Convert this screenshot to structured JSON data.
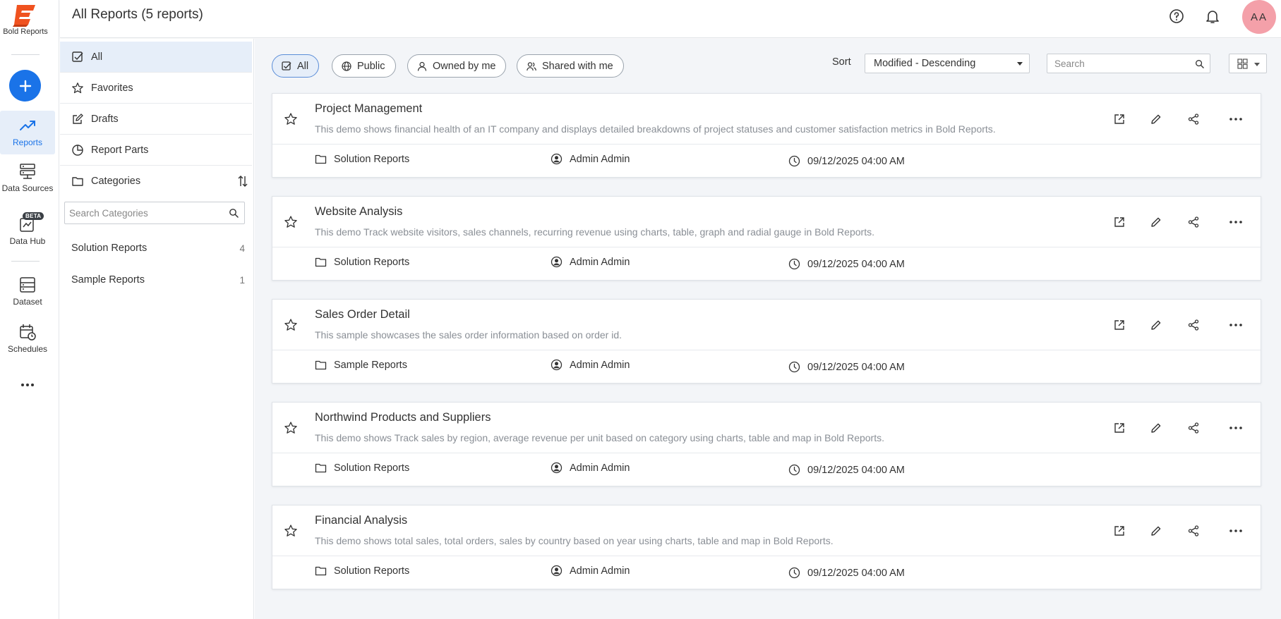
{
  "app": {
    "name": "Bold Reports"
  },
  "header": {
    "title": "All Reports (5 reports)",
    "avatar_initials": "AA"
  },
  "leftnav": {
    "items": [
      {
        "label": "Reports",
        "icon": "trending-up-icon"
      },
      {
        "label": "Data Sources",
        "icon": "server-icon"
      },
      {
        "label": "Data Hub",
        "icon": "data-hub-icon",
        "badge": "BETA"
      },
      {
        "label": "Dataset",
        "icon": "dataset-icon"
      },
      {
        "label": "Schedules",
        "icon": "calendar-clock-icon"
      }
    ]
  },
  "categories_panel": {
    "items": [
      {
        "label": "All"
      },
      {
        "label": "Favorites"
      },
      {
        "label": "Drafts"
      },
      {
        "label": "Report Parts"
      },
      {
        "label": "Categories"
      }
    ],
    "search_placeholder": "Search Categories",
    "categories": [
      {
        "label": "Solution Reports",
        "count": "4"
      },
      {
        "label": "Sample Reports",
        "count": "1"
      }
    ]
  },
  "toolbar": {
    "filters": [
      {
        "label": "All"
      },
      {
        "label": "Public"
      },
      {
        "label": "Owned by me"
      },
      {
        "label": "Shared with me"
      }
    ],
    "sort_label": "Sort",
    "sort_value": "Modified - Descending",
    "search_placeholder": "Search"
  },
  "reports": [
    {
      "title": "Project Management",
      "description": "This demo shows financial health of an IT company and displays detailed breakdowns of project statuses and customer satisfaction metrics in Bold Reports.",
      "category": "Solution Reports",
      "owner": "Admin Admin",
      "modified": "09/12/2025 04:00 AM"
    },
    {
      "title": "Website Analysis",
      "description": "This demo Track website visitors, sales channels, recurring revenue using charts, table, graph and radial gauge in Bold Reports.",
      "category": "Solution Reports",
      "owner": "Admin Admin",
      "modified": "09/12/2025 04:00 AM"
    },
    {
      "title": "Sales Order Detail",
      "description": "This sample showcases the sales order information based on order id.",
      "category": "Sample Reports",
      "owner": "Admin Admin",
      "modified": "09/12/2025 04:00 AM"
    },
    {
      "title": "Northwind Products and Suppliers",
      "description": "This demo shows Track sales by region, average revenue per unit based on category using charts, table and map in Bold Reports.",
      "category": "Solution Reports",
      "owner": "Admin Admin",
      "modified": "09/12/2025 04:00 AM"
    },
    {
      "title": "Financial Analysis",
      "description": "This demo shows total sales, total orders, sales by country based on year using charts, table and map in Bold Reports.",
      "category": "Solution Reports",
      "owner": "Admin Admin",
      "modified": "09/12/2025 04:00 AM"
    }
  ],
  "colors": {
    "accent": "#1a73e8",
    "logo": "#f0521f",
    "active_bg": "#e6eef9",
    "avatar_bg": "#f4a0a9"
  }
}
